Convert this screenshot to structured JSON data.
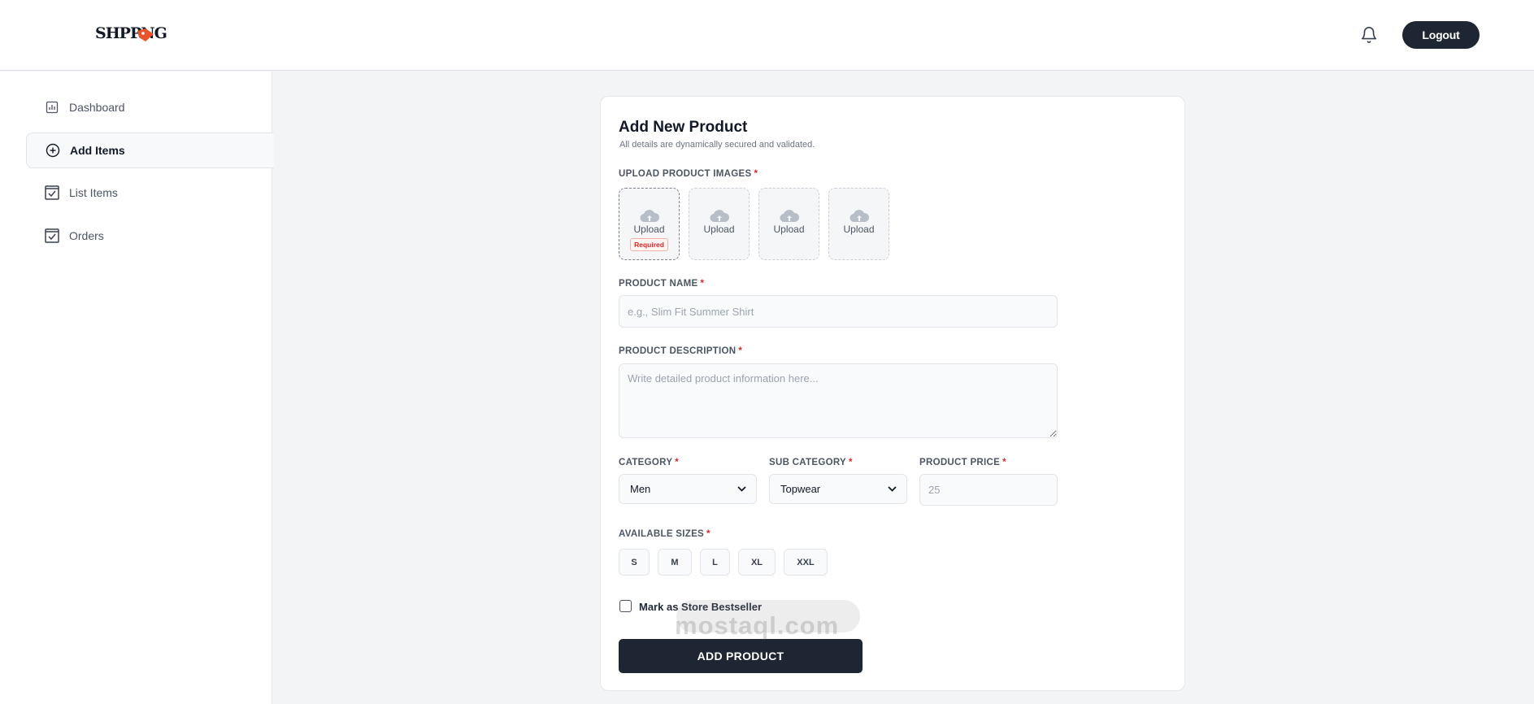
{
  "header": {
    "logo_text": "SHPPNG",
    "logout_label": "Logout"
  },
  "sidebar": {
    "items": [
      {
        "label": "Dashboard",
        "icon": "chart-icon"
      },
      {
        "label": "Add Items",
        "icon": "plus-circle-icon",
        "active": true
      },
      {
        "label": "List Items",
        "icon": "check-square-icon"
      },
      {
        "label": "Orders",
        "icon": "check-square-icon"
      }
    ]
  },
  "form": {
    "title": "Add New Product",
    "subtitle": "All details are dynamically secured and validated.",
    "images_label": "UPLOAD PRODUCT IMAGES",
    "upload_label": "Upload",
    "required_badge": "Required",
    "required_mark": "*",
    "name_label": "PRODUCT NAME",
    "name_placeholder": "e.g., Slim Fit Summer Shirt",
    "description_label": "PRODUCT DESCRIPTION",
    "description_placeholder": "Write detailed product information here...",
    "category_label": "CATEGORY",
    "category_value": "Men",
    "subcategory_label": "SUB CATEGORY",
    "subcategory_value": "Topwear",
    "price_label": "PRODUCT PRICE",
    "price_placeholder": "25",
    "sizes_label": "AVAILABLE SIZES",
    "sizes": [
      "S",
      "M",
      "L",
      "XL",
      "XXL"
    ],
    "bestseller_label": "Mark as Store Bestseller",
    "submit_label": "ADD PRODUCT"
  },
  "watermark": "mostaql.com",
  "colors": {
    "primary": "#1e2533",
    "required": "#dc2626",
    "background": "#f3f4f6"
  }
}
